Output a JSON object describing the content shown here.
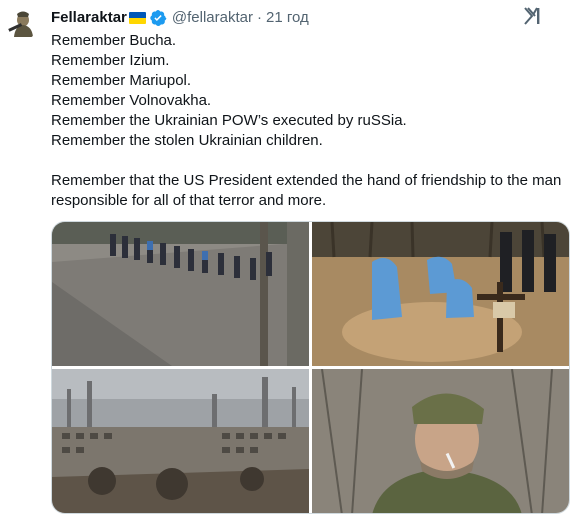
{
  "tweet": {
    "author_name": "Fellaraktar",
    "handle": "@fellaraktar",
    "separator": "·",
    "time": "21 год",
    "lines": [
      "Remember Bucha.",
      "Remember Izium.",
      "Remember Mariupol.",
      "Remember Volnovakha.",
      "Remember the Ukrainian POW’s executed by ruSSia.",
      "Remember the stolen Ukrainian children.",
      "",
      "Remember that the US President extended the hand of friendship to the man responsible for all of that terror and more."
    ]
  },
  "icons": {
    "verified": "verified-badge-icon",
    "flag": "ukraine-flag-icon",
    "logo": "x-grok-logo-icon"
  },
  "colors": {
    "verified_blue": "#1d9bf0",
    "flag_blue": "#0057b7",
    "flag_yellow": "#ffd700",
    "muted_text": "#536471"
  },
  "photos": [
    "street-line-of-people-photo",
    "exhumation-forensic-workers-photo",
    "ruined-city-photo",
    "soldier-portrait-photo"
  ]
}
